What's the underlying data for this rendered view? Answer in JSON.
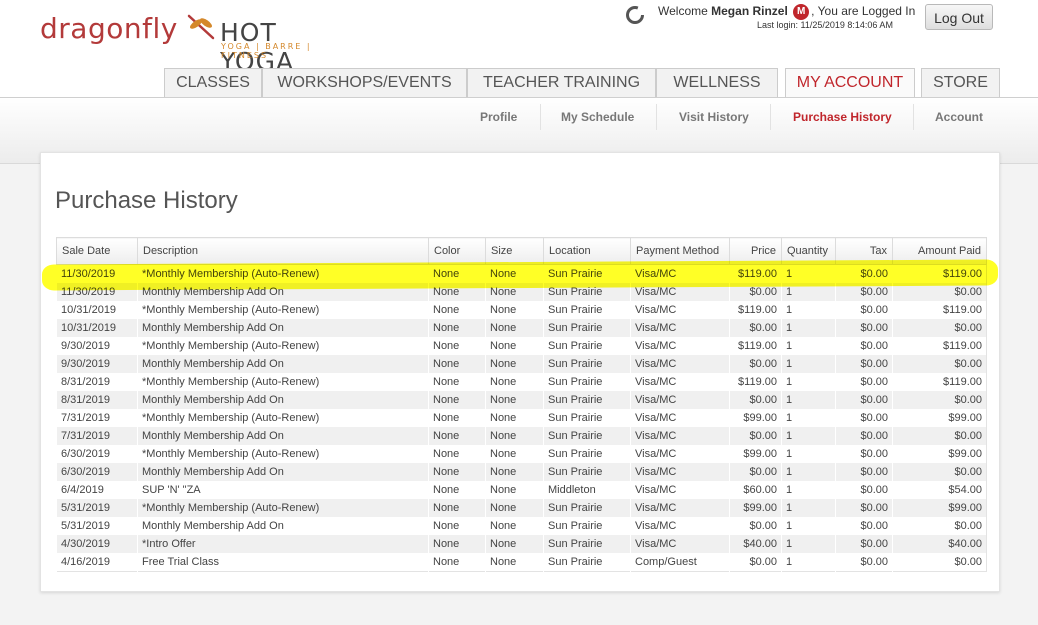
{
  "brand": {
    "name": "dragonfly",
    "name2": "HOT YOGA",
    "tagline": "YOGA | BARRE | FITNESS"
  },
  "user": {
    "welcome_prefix": "Welcome",
    "name": "Megan Rinzel",
    "avatar_letter": "M",
    "logged_in_text": ", You are Logged In",
    "last_login": "Last login: 11/25/2019 8:14:06 AM",
    "logout_label": "Log Out"
  },
  "nav": {
    "tabs": [
      {
        "label": "CLASSES"
      },
      {
        "label": "WORKSHOPS/EVENTS"
      },
      {
        "label": "TEACHER TRAINING"
      },
      {
        "label": "WELLNESS"
      },
      {
        "label": "MY ACCOUNT"
      },
      {
        "label": "STORE"
      }
    ],
    "active": "MY ACCOUNT"
  },
  "subnav": {
    "items": [
      {
        "label": "Profile"
      },
      {
        "label": "My Schedule"
      },
      {
        "label": "Visit History"
      },
      {
        "label": "Purchase History"
      },
      {
        "label": "Account"
      }
    ],
    "active": "Purchase History"
  },
  "page": {
    "title": "Purchase History"
  },
  "table": {
    "headers": [
      "Sale Date",
      "Description",
      "Color",
      "Size",
      "Location",
      "Payment Method",
      "Price",
      "Quantity",
      "Tax",
      "Amount Paid"
    ],
    "rows": [
      [
        "11/30/2019",
        "*Monthly Membership (Auto-Renew)",
        "None",
        "None",
        "Sun Prairie",
        "Visa/MC",
        "$119.00",
        "1",
        "$0.00",
        "$119.00"
      ],
      [
        "11/30/2019",
        "Monthly Membership Add On",
        "None",
        "None",
        "Sun Prairie",
        "Visa/MC",
        "$0.00",
        "1",
        "$0.00",
        "$0.00"
      ],
      [
        "10/31/2019",
        "*Monthly Membership (Auto-Renew)",
        "None",
        "None",
        "Sun Prairie",
        "Visa/MC",
        "$119.00",
        "1",
        "$0.00",
        "$119.00"
      ],
      [
        "10/31/2019",
        "Monthly Membership Add On",
        "None",
        "None",
        "Sun Prairie",
        "Visa/MC",
        "$0.00",
        "1",
        "$0.00",
        "$0.00"
      ],
      [
        "9/30/2019",
        "*Monthly Membership (Auto-Renew)",
        "None",
        "None",
        "Sun Prairie",
        "Visa/MC",
        "$119.00",
        "1",
        "$0.00",
        "$119.00"
      ],
      [
        "9/30/2019",
        "Monthly Membership Add On",
        "None",
        "None",
        "Sun Prairie",
        "Visa/MC",
        "$0.00",
        "1",
        "$0.00",
        "$0.00"
      ],
      [
        "8/31/2019",
        "*Monthly Membership (Auto-Renew)",
        "None",
        "None",
        "Sun Prairie",
        "Visa/MC",
        "$119.00",
        "1",
        "$0.00",
        "$119.00"
      ],
      [
        "8/31/2019",
        "Monthly Membership Add On",
        "None",
        "None",
        "Sun Prairie",
        "Visa/MC",
        "$0.00",
        "1",
        "$0.00",
        "$0.00"
      ],
      [
        "7/31/2019",
        "*Monthly Membership (Auto-Renew)",
        "None",
        "None",
        "Sun Prairie",
        "Visa/MC",
        "$99.00",
        "1",
        "$0.00",
        "$99.00"
      ],
      [
        "7/31/2019",
        "Monthly Membership Add On",
        "None",
        "None",
        "Sun Prairie",
        "Visa/MC",
        "$0.00",
        "1",
        "$0.00",
        "$0.00"
      ],
      [
        "6/30/2019",
        "*Monthly Membership (Auto-Renew)",
        "None",
        "None",
        "Sun Prairie",
        "Visa/MC",
        "$99.00",
        "1",
        "$0.00",
        "$99.00"
      ],
      [
        "6/30/2019",
        "Monthly Membership Add On",
        "None",
        "None",
        "Sun Prairie",
        "Visa/MC",
        "$0.00",
        "1",
        "$0.00",
        "$0.00"
      ],
      [
        "6/4/2019",
        "SUP 'N' \"ZA",
        "None",
        "None",
        "Middleton",
        "Visa/MC",
        "$60.00",
        "1",
        "$0.00",
        "$54.00"
      ],
      [
        "5/31/2019",
        "*Monthly Membership (Auto-Renew)",
        "None",
        "None",
        "Sun Prairie",
        "Visa/MC",
        "$99.00",
        "1",
        "$0.00",
        "$99.00"
      ],
      [
        "5/31/2019",
        "Monthly Membership Add On",
        "None",
        "None",
        "Sun Prairie",
        "Visa/MC",
        "$0.00",
        "1",
        "$0.00",
        "$0.00"
      ],
      [
        "4/30/2019",
        "*Intro Offer",
        "None",
        "None",
        "Sun Prairie",
        "Visa/MC",
        "$40.00",
        "1",
        "$0.00",
        "$40.00"
      ],
      [
        "4/16/2019",
        "Free Trial Class",
        "None",
        "None",
        "Sun Prairie",
        "Comp/Guest",
        "$0.00",
        "1",
        "$0.00",
        "$0.00"
      ]
    ]
  },
  "colors": {
    "accent": "#c0262c",
    "brand_orange": "#d4882b",
    "highlight": "#ffff00"
  },
  "icons": {
    "spinner": "spinner-icon",
    "logo_mark": "dragonfly-icon"
  }
}
